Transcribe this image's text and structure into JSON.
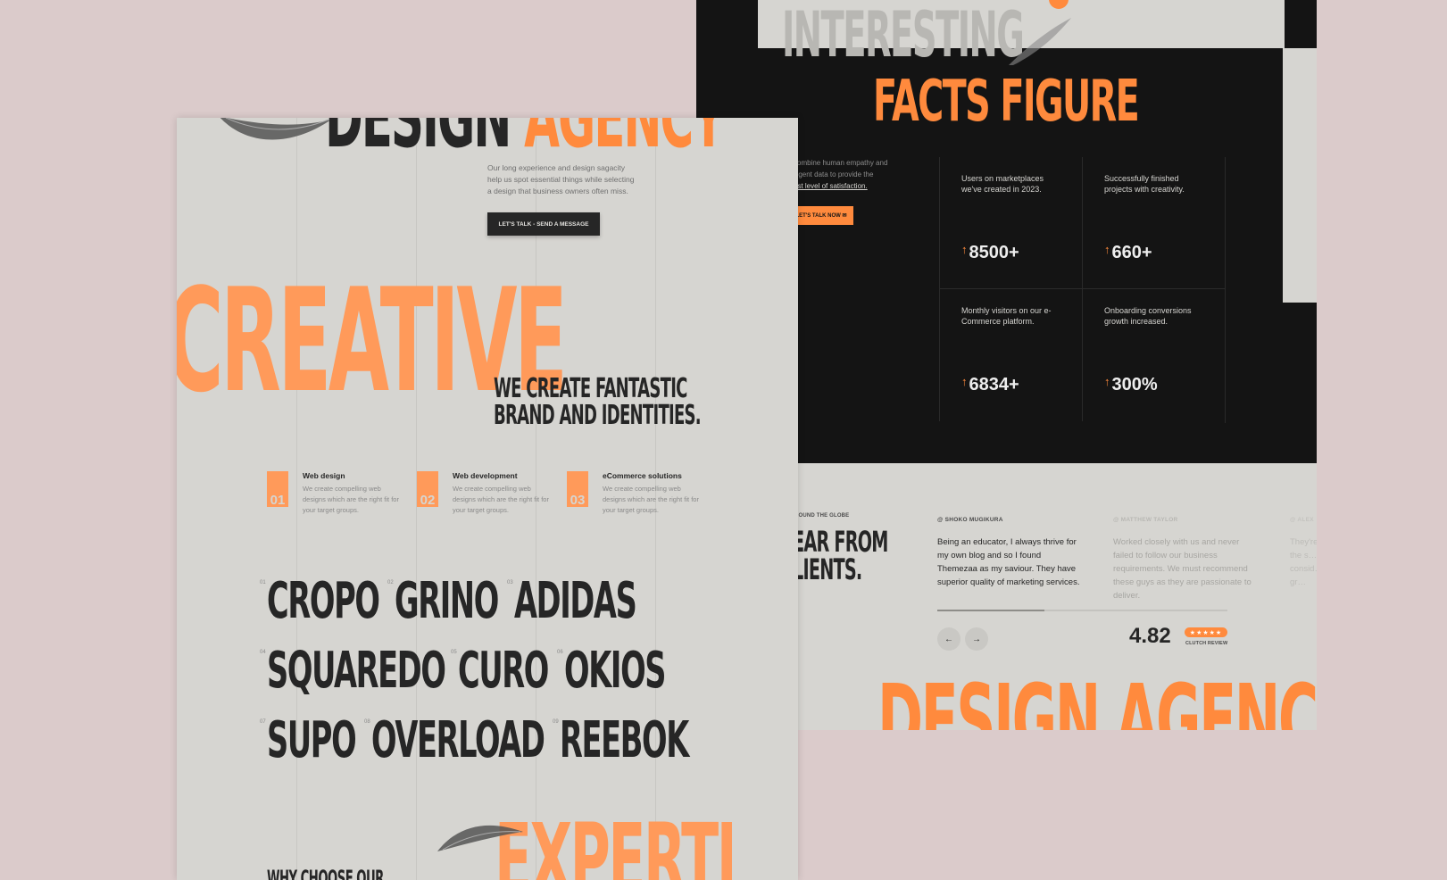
{
  "colors": {
    "background": "#dbcbcb",
    "accent": "#ff8a3d",
    "dark": "#141414",
    "light": "#d6d5d1",
    "ink": "#262626"
  },
  "left": {
    "hero": {
      "title_dark": "DESIGN",
      "title_orange": "AGENCY",
      "description": "Our long experience and design sagacity help us spot essential things while selecting a design that business owners often miss.",
      "button": "LET'S TALK - SEND A MESSAGE",
      "feather_icon": "feather-icon"
    },
    "creative": "CREATIVE",
    "tagline_line1": "WE CREATE FANTASTIC",
    "tagline_line2": "BRAND AND IDENTITIES.",
    "services": [
      {
        "num": "01",
        "title": "Web design",
        "desc": "We create compelling web designs which are the right fit for your target groups."
      },
      {
        "num": "02",
        "title": "Web development",
        "desc": "We create compelling web designs which are the right fit for your target groups."
      },
      {
        "num": "03",
        "title": "eCommerce solutions",
        "desc": "We create compelling web designs which are the right fit for your target groups."
      }
    ],
    "brands": [
      {
        "index": "01",
        "name": "CROPO"
      },
      {
        "index": "02",
        "name": "GRINO"
      },
      {
        "index": "03",
        "name": "ADIDAS"
      },
      {
        "index": "04",
        "name": "SQUAREDO"
      },
      {
        "index": "05",
        "name": "CURO"
      },
      {
        "index": "06",
        "name": "OKIOS"
      },
      {
        "index": "07",
        "name": "SUPO"
      },
      {
        "index": "08",
        "name": "OVERLOAD"
      },
      {
        "index": "09",
        "name": "REEBOK"
      }
    ],
    "why_choose": "WHY CHOOSE OUR",
    "expert": "EXPERTI"
  },
  "right": {
    "interesting": "INTERESTING",
    "facts_title": "FACTS FIGURE",
    "intro_line1": "combine human empathy and",
    "intro_line2": "lligent data to provide the",
    "intro_link": "est level of satisfaction.",
    "cta": "LET'S TALK NOW ✉",
    "stats": [
      {
        "label": "Users on marketplaces we've created in 2023.",
        "value": "8500+"
      },
      {
        "label": "Successfully finished projects with creativity.",
        "value": "660+"
      },
      {
        "label": "Monthly visitors on our e-Commerce platform.",
        "value": "6834+"
      },
      {
        "label": "Onboarding conversions growth increased.",
        "value": "300%"
      }
    ],
    "arrow": "↑",
    "around": "ROUND THE GLOBE",
    "hear_line1": "EAR FROM",
    "hear_line2": "LIENTS.",
    "reviews": [
      {
        "author": "@ SHOKO MUGIKURA",
        "text": "Being an educator, I always thrive for my own blog and so I found Themezaa as my saviour. They have superior quality of marketing services."
      },
      {
        "author": "@ MATTHEW TAYLOR",
        "text": "Worked closely with us and never failed to follow our business requirements. We must recommend these guys as they are passionate to deliver."
      },
      {
        "author": "@ ALEX",
        "text": "They're a… the s… consid… the gr…"
      }
    ],
    "prev": "←",
    "next": "→",
    "rating": "4.82",
    "stars": "★★★★★",
    "clutch": "CLUTCH REVIEW",
    "design_agency": "DESIGN AGENC"
  }
}
